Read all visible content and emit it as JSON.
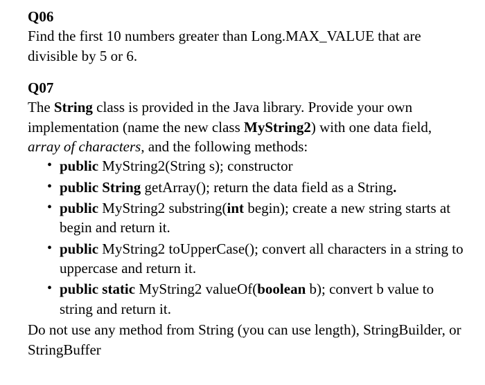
{
  "q06": {
    "heading": "Q06",
    "body": "Find the first 10 numbers greater than Long.MAX_VALUE that are divisible by 5 or 6."
  },
  "q07": {
    "heading": "Q07",
    "intro_l1_a": "The ",
    "intro_l1_b": "String",
    "intro_l1_c": " class is provided in the Java library.",
    "intro_l2": "Provide your own implementation (name the new class ",
    "intro_l3_a": "MyString2",
    "intro_l3_b": ") with one data field, ",
    "intro_l3_c": "array of characters",
    "intro_l3_d": ", and the following methods:",
    "bullets": {
      "b1": {
        "a": "public",
        "b": " MyString2(String s); constructor"
      },
      "b2": {
        "a": "public String",
        "b": " getArray(); return the data field as a String",
        "c": "."
      },
      "b3": {
        "a": "public",
        "b": " MyString2 substring(",
        "c": "int",
        "d": " begin); create a new string starts at begin and return it."
      },
      "b4": {
        "a": "public",
        "b": " MyString2 toUpperCase(); convert all characters in a string to uppercase and return it."
      },
      "b5": {
        "a": "public static",
        "b": " MyString2 valueOf(",
        "c": "boolean",
        "d": " b); convert b value to string and return it."
      }
    },
    "outro": "Do not use any method from String (you can use length), StringBuilder, or StringBuffer"
  }
}
